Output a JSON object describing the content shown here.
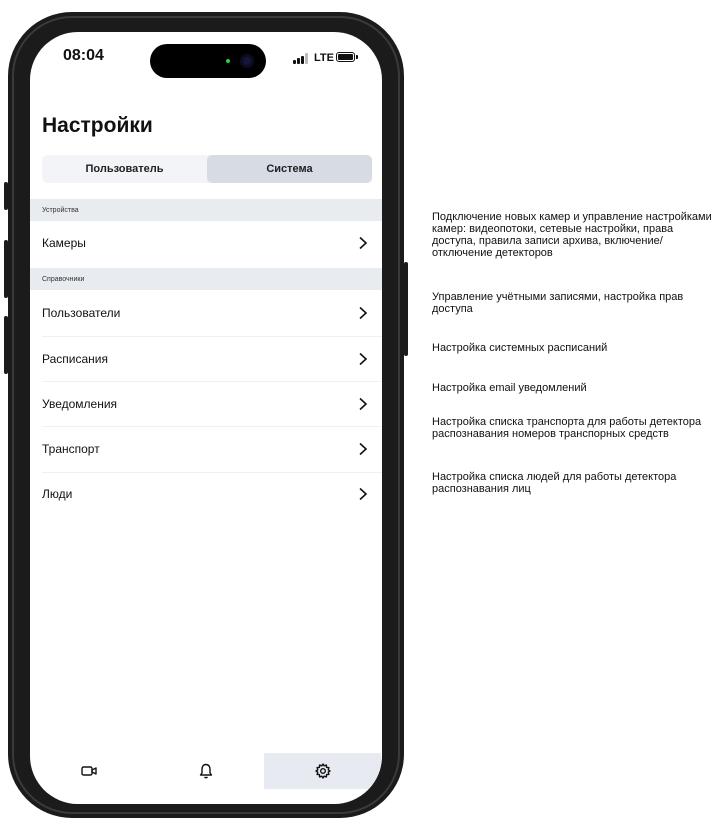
{
  "status_bar": {
    "time": "08:04",
    "network": "LTE"
  },
  "page_title": "Настройки",
  "segmented": {
    "tabs": [
      "Пользователь",
      "Система"
    ],
    "active": "Система"
  },
  "sections": [
    {
      "header": "Устройства",
      "items": [
        "Камеры"
      ]
    },
    {
      "header": "Справочники",
      "items": [
        "Пользователи",
        "Расписания",
        "Уведомления",
        "Транспорт",
        "Люди"
      ]
    }
  ],
  "tabbar": {
    "items": [
      "camera-icon",
      "bell-icon",
      "gear-icon"
    ],
    "active": "gear-icon"
  },
  "descriptions": [
    "Подключение новых камер и управление настройками камер: видеопотоки, сетевые настройки, права доступа, правила записи архива, включение/отключение детекторов",
    "Управление учётными записями, настройка прав доступа",
    "Настройка системных расписаний",
    "Настройка email уведомлений",
    "Настройка списка транспорта для работы детектора распознавания номеров транспорных средств",
    "Настройка списка людей для работы детектора распознавания лиц"
  ]
}
